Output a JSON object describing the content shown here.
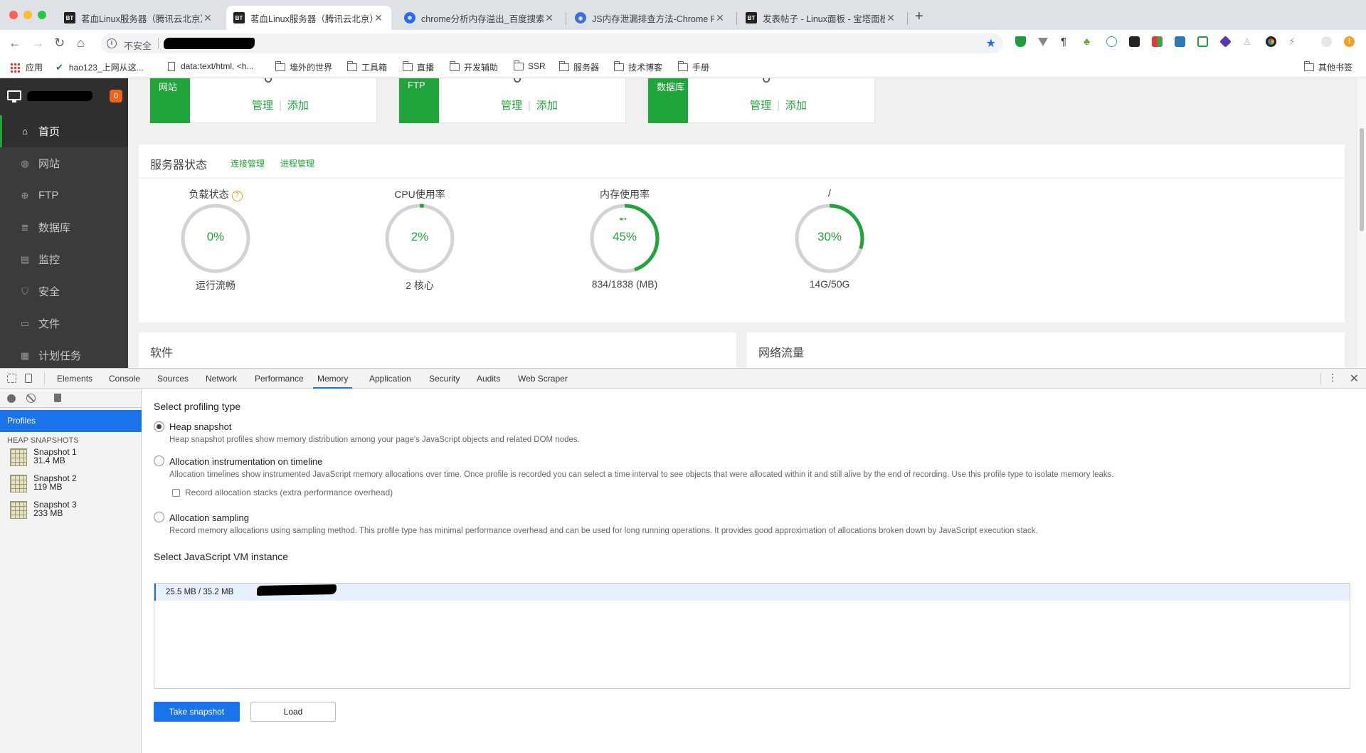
{
  "browser": {
    "tabs": [
      {
        "favicon": "BT",
        "title": "茗血Linux服务器（腾讯云北京）",
        "active": false
      },
      {
        "favicon": "BT",
        "title": "茗血Linux服务器（腾讯云北京）",
        "active": true
      },
      {
        "favicon": "baidu-paw-icon",
        "title": "chrome分析内存溢出_百度搜索",
        "active": false
      },
      {
        "favicon": "globe-icon",
        "title": "JS内存泄漏排查方法-Chrome Profiles",
        "active": false
      },
      {
        "favicon": "BT",
        "title": "发表帖子 - Linux面板 - 宝塔面板",
        "active": false
      }
    ],
    "new_tab": "+",
    "omnibox": {
      "security_text": "不安全"
    },
    "bookmarks": {
      "apps": "应用",
      "items": [
        "hao123_上网从这...",
        "data:text/html, <h...",
        "墙外的世界",
        "工具箱",
        "直播",
        "开发辅助",
        "SSR",
        "服务器",
        "技术博客",
        "手册"
      ],
      "other": "其他书签"
    },
    "colors": {
      "accent": "#1a73e8",
      "tabstrip": "#dee1e6"
    }
  },
  "panel": {
    "notification_count": "0",
    "sidebar": [
      {
        "icon": "home-icon",
        "label": "首页"
      },
      {
        "icon": "globe-icon",
        "label": "网站"
      },
      {
        "icon": "ftp-icon",
        "label": "FTP"
      },
      {
        "icon": "database-icon",
        "label": "数据库"
      },
      {
        "icon": "monitor-icon",
        "label": "监控"
      },
      {
        "icon": "shield-icon",
        "label": "安全"
      },
      {
        "icon": "folder-icon",
        "label": "文件"
      },
      {
        "icon": "calendar-icon",
        "label": "计划任务"
      }
    ],
    "cards": [
      {
        "tag": "网站",
        "manage": "管理",
        "add": "添加"
      },
      {
        "tag": "FTP",
        "manage": "管理",
        "add": "添加"
      },
      {
        "tag": "数据库",
        "manage": "管理",
        "add": "添加"
      }
    ],
    "server_status": {
      "title": "服务器状态",
      "links": [
        "连接管理",
        "进程管理"
      ],
      "gauges": [
        {
          "title": "负载状态",
          "percent": "0%",
          "value": 0,
          "subtitle": "运行流畅",
          "help": "?"
        },
        {
          "title": "CPU使用率",
          "percent": "2%",
          "value": 2,
          "subtitle": "2 核心"
        },
        {
          "title": "内存使用率",
          "percent": "45%",
          "value": 45,
          "subtitle": "834/1838 (MB)",
          "icon": "rocket-icon"
        },
        {
          "title": "/",
          "percent": "30%",
          "value": 30,
          "subtitle": "14G/50G"
        }
      ]
    },
    "software_title": "软件",
    "network_title": "网络流量",
    "colors": {
      "brand_green": "#20a53a",
      "sidebar_bg": "#3b3b3b",
      "badge": "#f0641e"
    }
  },
  "devtools": {
    "tabs": [
      "Elements",
      "Console",
      "Sources",
      "Network",
      "Performance",
      "Memory",
      "Application",
      "Security",
      "Audits",
      "Web Scraper"
    ],
    "active_tab": "Memory",
    "left": {
      "profiles_label": "Profiles",
      "heap_header": "HEAP SNAPSHOTS",
      "snapshots": [
        {
          "name": "Snapshot 1",
          "size": "31.4 MB"
        },
        {
          "name": "Snapshot 2",
          "size": "119 MB"
        },
        {
          "name": "Snapshot 3",
          "size": "233 MB"
        }
      ]
    },
    "main": {
      "select_type_title": "Select profiling type",
      "options": [
        {
          "label": "Heap snapshot",
          "desc": "Heap snapshot profiles show memory distribution among your page's JavaScript objects and related DOM nodes.",
          "checked": true
        },
        {
          "label": "Allocation instrumentation on timeline",
          "desc": "Allocation timelines show instrumented JavaScript memory allocations over time. Once profile is recorded you can select a time interval to see objects that were allocated within it and still alive by the end of recording. Use this profile type to isolate memory leaks.",
          "checked": false
        },
        {
          "label": "Allocation sampling",
          "desc": "Record memory allocations using sampling method. This profile type has minimal performance overhead and can be used for long running operations. It provides good approximation of allocations broken down by JavaScript execution stack.",
          "checked": false
        }
      ],
      "record_stacks_label": "Record allocation stacks (extra performance overhead)",
      "vm_title": "Select JavaScript VM instance",
      "vm_instance": "25.5 MB / 35.2 MB",
      "take_snapshot": "Take snapshot",
      "load": "Load"
    }
  }
}
